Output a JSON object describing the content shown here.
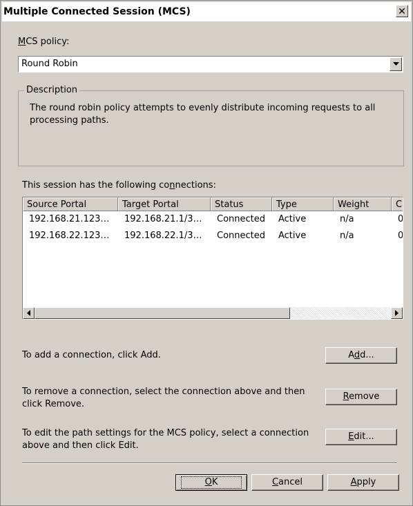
{
  "window": {
    "title": "Multiple Connected Session (MCS)",
    "close_glyph": "✕"
  },
  "policy": {
    "label_accel": "M",
    "label_rest": "CS policy:",
    "selected": "Round Robin"
  },
  "description": {
    "title": "Description",
    "text": "The round robin policy attempts to evenly distribute incoming requests to all processing paths."
  },
  "connections": {
    "label_before": "This session has the following co",
    "label_accel": "n",
    "label_after": "nections:",
    "columns": [
      "Source Portal",
      "Target Portal",
      "Status",
      "Type",
      "Weight",
      "C"
    ],
    "rows": [
      [
        "192.168.21.123…",
        "192.168.21.1/3…",
        "Connected",
        "Active",
        "n/a",
        "0"
      ],
      [
        "192.168.22.123…",
        "192.168.22.1/3…",
        "Connected",
        "Active",
        "n/a",
        "0"
      ]
    ]
  },
  "actions": {
    "add_text": "To add a connection, click Add.",
    "add_button_pre": "A",
    "add_button_accel": "d",
    "add_button_post": "d...",
    "remove_text": "To remove a connection, select the connection above and then click Remove.",
    "remove_button_accel": "R",
    "remove_button_post": "emove",
    "edit_text": "To edit the path settings for the MCS policy, select a connection above and then click Edit.",
    "edit_button_accel": "E",
    "edit_button_post": "dit..."
  },
  "footer": {
    "ok_accel": "O",
    "ok_post": "K",
    "cancel_accel": "C",
    "cancel_post": "ancel",
    "apply_accel": "A",
    "apply_post": "pply"
  }
}
